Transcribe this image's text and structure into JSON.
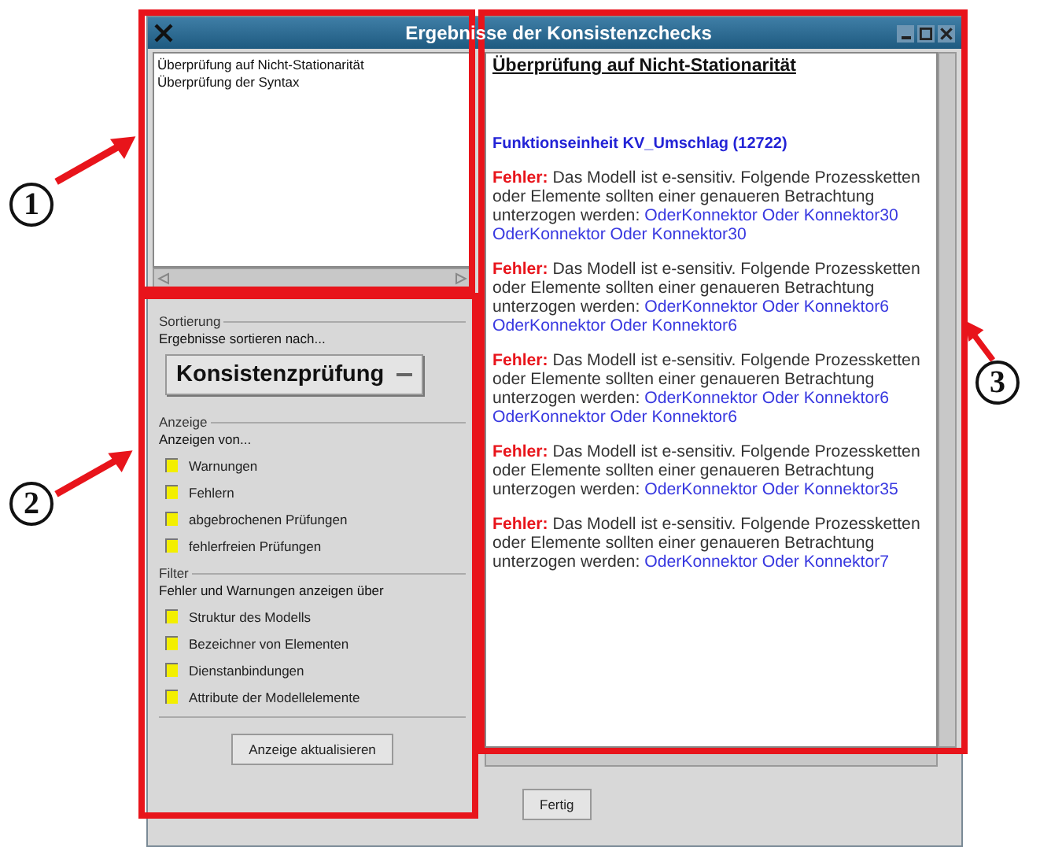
{
  "window": {
    "title": "Ergebnisse der Konsistenzchecks"
  },
  "checks_list": [
    {
      "label": "Überprüfung auf Nicht-Stationarität",
      "selected": false
    },
    {
      "label": "Überprüfung der Syntax",
      "selected": false
    }
  ],
  "sorting": {
    "heading": "Sortierung",
    "label": "Ergebnisse sortieren nach...",
    "value": "Konsistenzprüfung"
  },
  "display": {
    "heading": "Anzeige",
    "label": "Anzeigen von...",
    "options": [
      {
        "label": "Warnungen",
        "checked": true
      },
      {
        "label": "Fehlern",
        "checked": true
      },
      {
        "label": "abgebrochenen Prüfungen",
        "checked": true
      },
      {
        "label": "fehlerfreien Prüfungen",
        "checked": true
      }
    ]
  },
  "filter": {
    "heading": "Filter",
    "label": "Fehler und Warnungen anzeigen über",
    "options": [
      {
        "label": "Struktur des Modells",
        "checked": true
      },
      {
        "label": "Bezeichner von Elementen",
        "checked": true
      },
      {
        "label": "Dienstanbindungen",
        "checked": true
      },
      {
        "label": "Attribute der Modellelemente",
        "checked": true
      }
    ]
  },
  "refresh_button": "Anzeige aktualisieren",
  "results": {
    "heading": "Überprüfung auf Nicht-Stationarität",
    "unit": "Funktionseinheit KV_Umschlag (12722)",
    "entries": [
      {
        "prefix": "Fehler:",
        "text": "Das Modell ist e-sensitiv. Folgende Prozessketten oder Elemente sollten einer genaueren Betrachtung unterzogen werden:",
        "link": "OderKonnektor Oder Konnektor30 OderKonnektor Oder Konnektor30"
      },
      {
        "prefix": "Fehler:",
        "text": "Das Modell ist e-sensitiv. Folgende Prozessketten oder Elemente sollten einer genaueren Betrachtung unterzogen werden:",
        "link": "OderKonnektor Oder Konnektor6 OderKonnektor Oder Konnektor6"
      },
      {
        "prefix": "Fehler:",
        "text": "Das Modell ist e-sensitiv. Folgende Prozessketten oder Elemente sollten einer genaueren Betrachtung unterzogen werden:",
        "link": "OderKonnektor Oder Konnektor6 OderKonnektor Oder Konnektor6"
      },
      {
        "prefix": "Fehler:",
        "text": "Das Modell ist e-sensitiv. Folgende Prozessketten oder Elemente sollten einer genaueren Betrachtung unterzogen werden:",
        "link": "OderKonnektor Oder Konnektor35"
      },
      {
        "prefix": "Fehler:",
        "text": "Das Modell ist e-sensitiv. Folgende Prozessketten oder Elemente sollten einer genaueren Betrachtung unterzogen werden:",
        "link": "OderKonnektor Oder Konnektor7"
      }
    ]
  },
  "done_button": "Fertig",
  "callouts": [
    {
      "number": "1"
    },
    {
      "number": "2"
    },
    {
      "number": "3"
    }
  ]
}
